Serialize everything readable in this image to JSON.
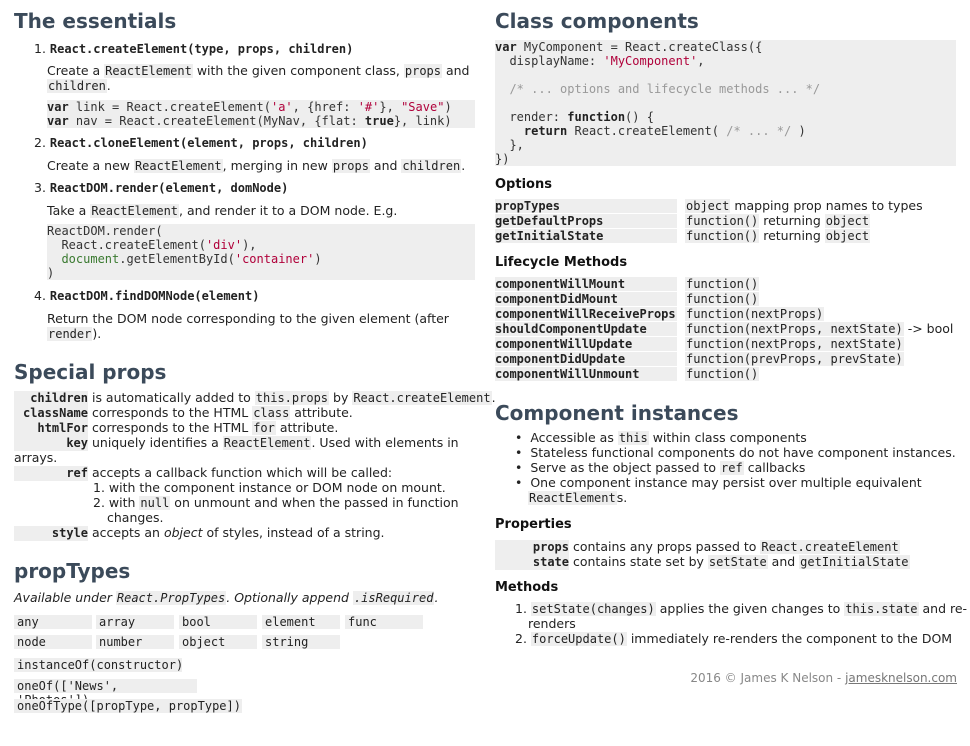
{
  "left": {
    "essentials": {
      "title": "The essentials",
      "items": [
        {
          "num": "1.",
          "sig": "React.createElement(type, props, children)",
          "desc_a": "Create a ",
          "desc_code1": "ReactElement",
          "desc_b": " with the given component class, ",
          "desc_code2": "props",
          "desc_c": " and",
          "desc_code3": "children",
          "desc_d": "."
        },
        {
          "num": "2.",
          "sig": "React.cloneElement(element, props, children)",
          "desc_a": "Create a new ",
          "desc_code1": "ReactElement",
          "desc_b": ", merging in new ",
          "desc_code2": "props",
          "desc_c": " and ",
          "desc_code3": "children",
          "desc_d": "."
        },
        {
          "num": "3.",
          "sig": "ReactDOM.render(element, domNode)",
          "desc_a": "Take a ",
          "desc_code1": "ReactElement",
          "desc_b": ", and render it to a DOM node. E.g."
        },
        {
          "num": "4.",
          "sig": "ReactDOM.findDOMNode(element)",
          "desc_a": "Return the DOM node corresponding to the given element (after",
          "desc_code1": "render",
          "desc_b": ")."
        }
      ]
    },
    "special": {
      "title": "Special props",
      "children_name": "children",
      "children_a": " is automatically added to ",
      "children_code1": "this.props",
      "children_b": " by ",
      "children_code2": "React.createElement",
      "children_c": ".",
      "classname_name": "className",
      "classname_a": " corresponds to the HTML ",
      "classname_code": "class",
      "classname_b": " attribute.",
      "htmlfor_name": "htmlFor",
      "htmlfor_a": " corresponds to the HTML ",
      "htmlfor_code": "for",
      "htmlfor_b": " attribute.",
      "key_name": "key",
      "key_a": " uniquely identifies a ",
      "key_code": "ReactElement",
      "key_b": ". Used with elements in",
      "key_c": "arrays.",
      "ref_name": "ref",
      "ref_a": " accepts a callback function which will be called:",
      "ref_1_num": "1.",
      "ref_1": "with the component instance or DOM node on mount.",
      "ref_2_num": "2.",
      "ref_2a": "with ",
      "ref_2_code": "null",
      "ref_2b": " on unmount and when the passed in function",
      "ref_2c": "changes.",
      "style_name": "style",
      "style_a": " accepts an ",
      "style_em": "object",
      "style_b": " of styles, instead of a string."
    },
    "proptypes": {
      "title": "propTypes",
      "sub_a": "Available under ",
      "sub_code1": "React.PropTypes",
      "sub_b": ". Optionally append ",
      "sub_code2": ".isRequired",
      "sub_c": ".",
      "grid_row1": [
        "any",
        "array",
        "bool",
        "element",
        "func"
      ],
      "grid_row2": [
        "node",
        "number",
        "object",
        "string"
      ],
      "extra": [
        "instanceOf(constructor)",
        "oneOf(['News', 'Photos'])",
        "oneOfType([propType, propType])"
      ]
    }
  },
  "right": {
    "class_components": {
      "title": "Class components"
    },
    "options": {
      "title": "Options",
      "rows": [
        {
          "name": "propTypes",
          "code": "object",
          "text": " mapping prop names to types"
        },
        {
          "name": "getDefaultProps",
          "code": "function()",
          "text": " returning ",
          "code2": "object"
        },
        {
          "name": "getInitialState",
          "code": "function()",
          "text": " returning ",
          "code2": "object"
        }
      ]
    },
    "lifecycle": {
      "title": "Lifecycle Methods",
      "rows": [
        {
          "name": "componentWillMount",
          "sig": "function()"
        },
        {
          "name": "componentDidMount",
          "sig": "function()"
        },
        {
          "name": "componentWillReceiveProps",
          "sig": "function(nextProps)"
        },
        {
          "name": "shouldComponentUpdate",
          "sig": "function(nextProps, nextState)",
          "extra": " -> bool"
        },
        {
          "name": "componentWillUpdate",
          "sig": "function(nextProps, nextState)"
        },
        {
          "name": "componentDidUpdate",
          "sig": "function(prevProps, prevState)"
        },
        {
          "name": "componentWillUnmount",
          "sig": "function()"
        }
      ]
    },
    "instances": {
      "title": "Component instances",
      "b1a": "Accessible as ",
      "b1code": "this",
      "b1b": " within class components",
      "b2": "Stateless functional components do not have component instances.",
      "b3a": "Serve as the object passed to ",
      "b3code": "ref",
      "b3b": " callbacks",
      "b4a": "One component instance may persist over multiple equivalent",
      "b4code": "ReactElement",
      "b4b": "s."
    },
    "properties": {
      "title": "Properties",
      "props_name": "props",
      "props_a": " contains any props passed to ",
      "props_code": "React.createElement",
      "state_name": "state",
      "state_a": " contains state set by ",
      "state_code1": "setState",
      "state_b": " and ",
      "state_code2": "getInitialState"
    },
    "methods": {
      "title": "Methods",
      "m1_num": "1.",
      "m1_code": "setState(changes)",
      "m1_a": " applies the given changes to ",
      "m1_code2": "this.state",
      "m1_b": " and re-",
      "m1_c": "renders",
      "m2_num": "2.",
      "m2_code": "forceUpdate()",
      "m2_a": " immediately re-renders the component to the DOM"
    },
    "footer": {
      "text": "2016 © James K Nelson - ",
      "link": "jamesknelson.com"
    }
  }
}
